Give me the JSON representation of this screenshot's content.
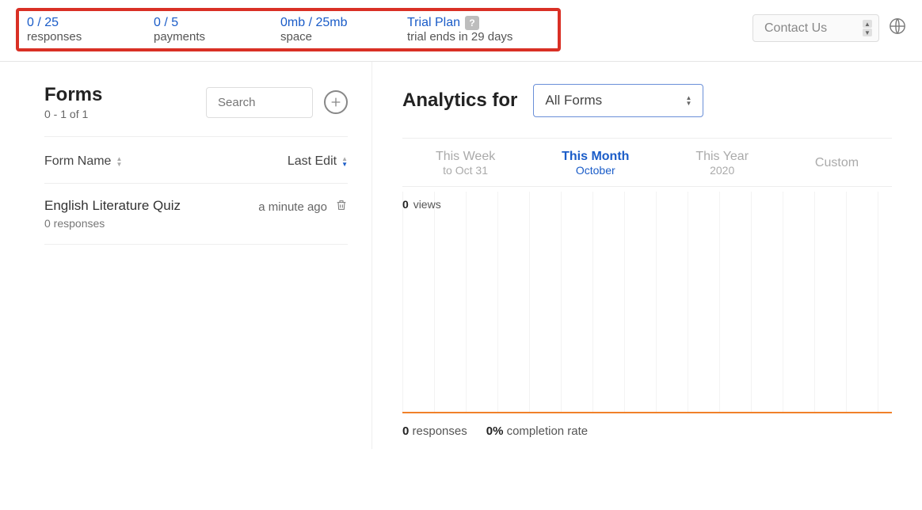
{
  "top": {
    "responses": {
      "value": "0 / 25",
      "label": "responses"
    },
    "payments": {
      "value": "0 / 5",
      "label": "payments"
    },
    "space": {
      "value": "0mb / 25mb",
      "label": "space"
    },
    "plan": {
      "title": "Trial Plan",
      "help": "?",
      "sub": "trial ends in 29 days"
    },
    "contact": "Contact Us"
  },
  "forms": {
    "title": "Forms",
    "range": "0 - 1 of 1",
    "search_placeholder": "Search",
    "columns": {
      "name": "Form Name",
      "edit": "Last Edit"
    },
    "items": [
      {
        "name": "English Literature Quiz",
        "responses": "0 responses",
        "edited": "a minute ago"
      }
    ]
  },
  "analytics": {
    "title": "Analytics for",
    "form_selected": "All Forms",
    "periods": [
      {
        "label": "This Week",
        "sub": "to Oct 31",
        "active": false
      },
      {
        "label": "This Month",
        "sub": "October",
        "active": true
      },
      {
        "label": "This Year",
        "sub": "2020",
        "active": false
      },
      {
        "label": "Custom",
        "sub": "",
        "active": false
      }
    ],
    "views": {
      "count": "0",
      "label": "views"
    },
    "bottom": {
      "responses_count": "0",
      "responses_label": "responses",
      "completion_count": "0%",
      "completion_label": "completion rate"
    }
  },
  "chart_data": {
    "type": "bar",
    "title": "views",
    "categories": [],
    "values": [],
    "ylim": [
      0,
      0
    ]
  }
}
